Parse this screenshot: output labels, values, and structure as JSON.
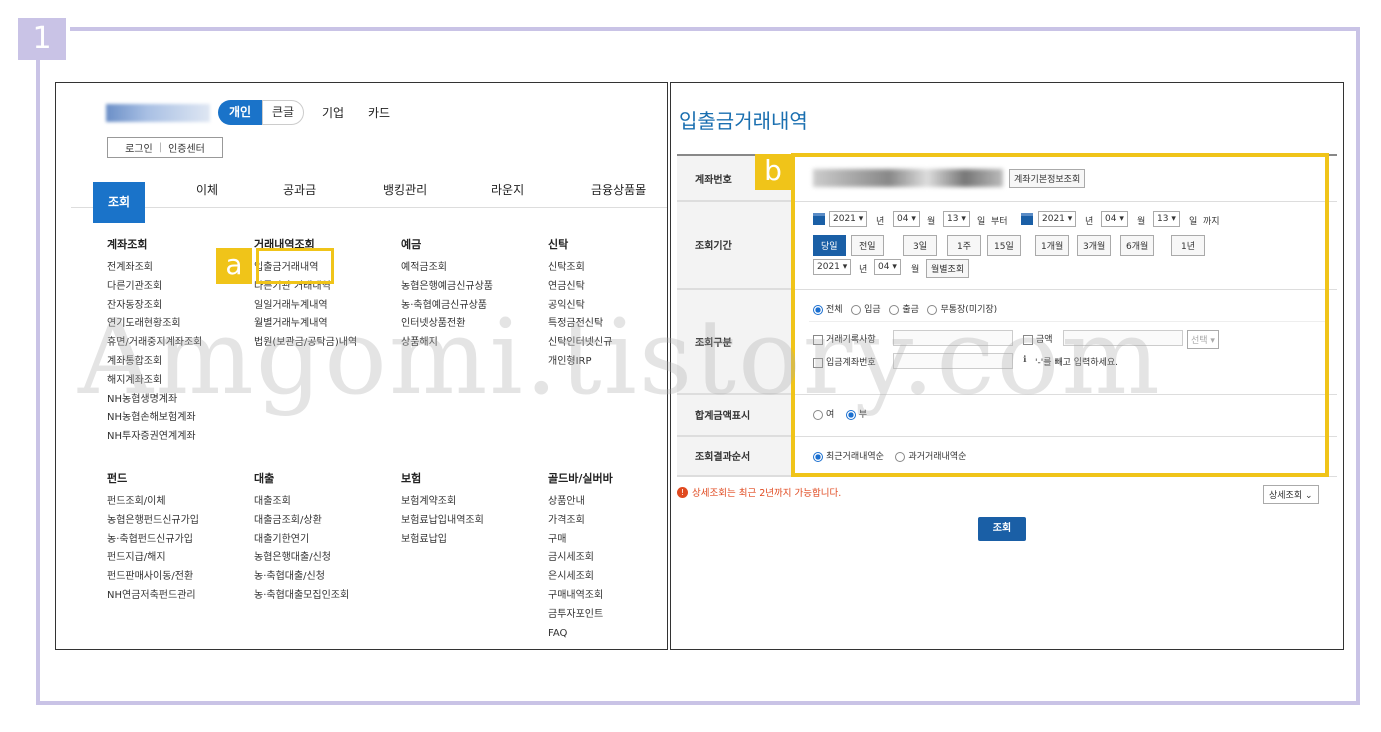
{
  "step_number": "1",
  "left": {
    "tabs": {
      "personal": "개인",
      "kbig": "큰글"
    },
    "top_links": [
      "기업",
      "카드"
    ],
    "login": "로그인",
    "cert_center": "인증센터",
    "nav": [
      "조회",
      "이체",
      "공과금",
      "뱅킹관리",
      "라운지",
      "금융상품몰"
    ],
    "columns_top": [
      {
        "head": "계좌조회",
        "items": [
          "전계좌조회",
          "다른기관조회",
          "잔자동장조회",
          "연기도래현황조회",
          "휴면/거래중지계좌조회",
          "계좌통합조회",
          "해지계좌조회",
          "NH농협생명계좌",
          "NH농협손해보험계좌",
          "NH투자증권연계계좌"
        ]
      },
      {
        "head": "거래내역조회",
        "items": [
          "입출금거래내역",
          "다른기관 거래내역",
          "일일거래누계내역",
          "월별거래누계내역",
          "법원(보관금/공탁금)내역"
        ]
      },
      {
        "head": "예금",
        "items": [
          "예적금조회",
          "농협은행예금신규상품",
          "농·축협예금신규상품",
          "인터넷상품전환",
          "상품해지"
        ]
      },
      {
        "head": "신탁",
        "items": [
          "신탁조회",
          "연금신탁",
          "공익신탁",
          "특정금전신탁",
          "신탁인터넷신규",
          "개인형IRP"
        ]
      }
    ],
    "columns_bottom": [
      {
        "head": "펀드",
        "items": [
          "펀드조회/이체",
          "농협은행펀드신규가입",
          "농·축협펀드신규가입",
          "펀드지급/해지",
          "펀드판매사이동/전환",
          "NH연금저축펀드관리"
        ]
      },
      {
        "head": "대출",
        "items": [
          "대출조회",
          "대출금조회/상환",
          "대출기한연기",
          "농협은행대출/신청",
          "농·축협대출/신청",
          "농·축협대출모집인조회"
        ]
      },
      {
        "head": "보험",
        "items": [
          "보험계약조회",
          "보험료납입내역조회",
          "보험료납입"
        ]
      },
      {
        "head": "골드바/실버바",
        "items": [
          "상품안내",
          "가격조회",
          "구매",
          "금시세조회",
          "은시세조회",
          "구매내역조회",
          "금투자포인트",
          "FAQ"
        ]
      }
    ],
    "marker": "a"
  },
  "right": {
    "title": "입출금거래내역",
    "marker": "b",
    "labels": {
      "account": "계좌번호",
      "period": "조회기간",
      "type": "조회구분",
      "total": "합계금액표시",
      "order": "조회결과순서"
    },
    "account_button": "계좌기본정보조회",
    "date_from": {
      "year": "2021",
      "month": "04",
      "day": "13"
    },
    "date_to": {
      "year": "2021",
      "month": "04",
      "day": "13"
    },
    "units": {
      "year": "년",
      "month": "월",
      "day": "일",
      "from": "부터",
      "to": "까지"
    },
    "period_buttons": [
      "당일",
      "전일",
      "3일",
      "1주",
      "15일",
      "1개월",
      "3개월",
      "6개월",
      "1년"
    ],
    "month_select": {
      "year": "2021",
      "month": "04",
      "button": "월별조회"
    },
    "type_options": [
      "전체",
      "입금",
      "출금",
      "무통장(미기장)"
    ],
    "filter": {
      "memo": "거래기록사항",
      "amount": "금액",
      "amount_select": "선택",
      "counter_account": "입금계좌번호",
      "hint": "'-'를 빼고 입력하세요."
    },
    "total_options": [
      "여",
      "부"
    ],
    "order_options": [
      "최근거래내역순",
      "과거거래내역순"
    ],
    "notice": "상세조회는 최근 2년까지 가능합니다.",
    "detail_button": "상세조회",
    "search_button": "조회"
  },
  "watermark": "Amgomi.tistory.com"
}
